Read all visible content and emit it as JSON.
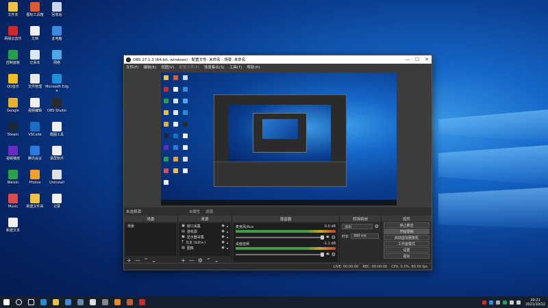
{
  "desktop": {
    "icons": [
      {
        "label": "文件夹",
        "color": "#f0c040"
      },
      {
        "label": "图标工具箱",
        "color": "#e05a30"
      },
      {
        "label": "回收站",
        "color": "#c8d8e8"
      },
      {
        "label": "网易云音乐",
        "color": "#d02828"
      },
      {
        "label": "文档",
        "color": "#f0f0f0"
      },
      {
        "label": "此电脑",
        "color": "#3a8be0"
      },
      {
        "label": "控制面板",
        "color": "#2a9d4a"
      },
      {
        "label": "记事本",
        "color": "#d8e8f8"
      },
      {
        "label": "网络",
        "color": "#4aa8e8"
      },
      {
        "label": "QQ音乐",
        "color": "#f0c020"
      },
      {
        "label": "文件管理",
        "color": "#e8e8e8"
      },
      {
        "label": "Microsoft Edge",
        "color": "#1e90d8"
      },
      {
        "label": "Google",
        "color": "#e8b030"
      },
      {
        "label": "视频编辑",
        "color": "#f0f0f0"
      },
      {
        "label": "OBS Studio",
        "color": "#2a2a2a"
      },
      {
        "label": "Steam",
        "color": "#1b2838"
      },
      {
        "label": "VSCode",
        "color": "#1a6fc0"
      },
      {
        "label": "截图工具",
        "color": "#f0f0f0"
      },
      {
        "label": "视频播放",
        "color": "#6a2ac0"
      },
      {
        "label": "腾讯会议",
        "color": "#2a7ae0"
      },
      {
        "label": "录屏软件",
        "color": "#f0f0f0"
      },
      {
        "label": "Weixin",
        "color": "#2aa04a"
      },
      {
        "label": "Photos",
        "color": "#f0a030"
      },
      {
        "label": "Uninstall",
        "color": "#e0e0e0"
      },
      {
        "label": "Music",
        "color": "#e04a4a"
      },
      {
        "label": "新建文件夹",
        "color": "#f0c040"
      },
      {
        "label": "记录",
        "color": "#f0f0f0"
      },
      {
        "label": "新建文本",
        "color": "#f0f0f0"
      }
    ]
  },
  "obs": {
    "title": "OBS 27.1.3 (64-bit, windows) - 配置文件: 未命名 - 场景: 未命名",
    "window_controls": [
      "—",
      "☐",
      "✕"
    ],
    "menu": [
      "文件(F)",
      "编辑(E)",
      "视图(V)",
      "配置文件(P)",
      "场景集合(S)",
      "工具(T)",
      "帮助(H)"
    ],
    "source_bar": {
      "label": "未选择源",
      "properties": "⚙属性",
      "filters": "滤镜"
    },
    "docks": {
      "scenes": {
        "title": "场景",
        "items": [
          "场景"
        ]
      },
      "sources": {
        "title": "来源",
        "items": [
          {
            "icon": "▣",
            "label": "窗口采集"
          },
          {
            "icon": "▤",
            "label": "游戏源"
          },
          {
            "icon": "▣",
            "label": "显示器采集"
          },
          {
            "icon": "T",
            "label": "文本 (GDI+)"
          },
          {
            "icon": "▨",
            "label": "图像"
          }
        ]
      },
      "mixer": {
        "title": "混音器",
        "channels": [
          {
            "name": "麦克风/Aux",
            "db": "0.0 dB"
          },
          {
            "name": "桌面音频",
            "db": "-1.1 dB"
          }
        ]
      },
      "transitions": {
        "title": "转场特效",
        "type": "淡出",
        "duration_label": "时长",
        "duration": "300 ms"
      },
      "controls": {
        "title": "控件",
        "buttons": [
          "停止推流",
          "开始录制",
          "启动虚拟摄像机",
          "工作室模式",
          "设置",
          "退出"
        ]
      }
    },
    "tool_glyphs": {
      "add": "+",
      "remove": "—",
      "settings": "⚙",
      "up": "⌃",
      "down": "⌄"
    },
    "status": {
      "live": "LIVE: 00:00:00",
      "rec": "REC: 00:00:00",
      "cpu": "CPU: 0.5%, 60.00 fps"
    }
  },
  "taskbar": {
    "items": [
      {
        "name": "start",
        "color": "#ffffff"
      },
      {
        "name": "search",
        "color": "#ffffff"
      },
      {
        "name": "task-view",
        "color": "#ffffff"
      },
      {
        "name": "edge",
        "color": "#1e90d8"
      },
      {
        "name": "file-explorer",
        "color": "#f0c040"
      },
      {
        "name": "chart",
        "color": "#3a8be0"
      },
      {
        "name": "steam",
        "color": "#6a8aaa"
      },
      {
        "name": "obs",
        "color": "#dddddd"
      },
      {
        "name": "app",
        "color": "#888888"
      },
      {
        "name": "orange-app",
        "color": "#f08a20"
      },
      {
        "name": "game",
        "color": "#c06030"
      },
      {
        "name": "netease",
        "color": "#d02828"
      }
    ],
    "time": "20:21",
    "date": "2021/10/12"
  }
}
